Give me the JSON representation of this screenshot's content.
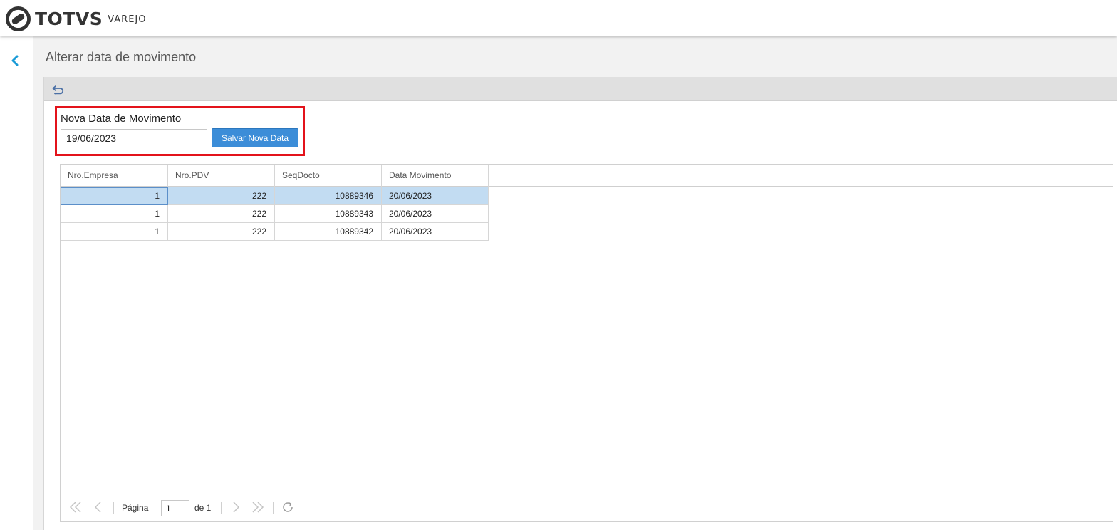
{
  "header": {
    "brand": "TOTVS",
    "product": "VAREJO"
  },
  "page": {
    "title": "Alterar data de movimento"
  },
  "form": {
    "label": "Nova Data de Movimento",
    "date_value": "19/06/2023",
    "save_label": "Salvar Nova Data"
  },
  "grid": {
    "columns": [
      "Nro.Empresa",
      "Nro.PDV",
      "SeqDocto",
      "Data Movimento"
    ],
    "rows": [
      {
        "empresa": "1",
        "pdv": "222",
        "seq": "10889346",
        "data": "20/06/2023",
        "selected": true
      },
      {
        "empresa": "1",
        "pdv": "222",
        "seq": "10889343",
        "data": "20/06/2023",
        "selected": false
      },
      {
        "empresa": "1",
        "pdv": "222",
        "seq": "10889342",
        "data": "20/06/2023",
        "selected": false
      }
    ]
  },
  "pager": {
    "page_label": "Página",
    "current_page": "1",
    "of_label": "de 1"
  },
  "icons": {
    "back": "chevron-left-icon",
    "undo": "undo-icon",
    "first": "double-chevron-left-icon",
    "prev": "chevron-left-icon",
    "next": "chevron-right-icon",
    "last": "double-chevron-right-icon",
    "refresh": "refresh-icon"
  },
  "colors": {
    "accent": "#3c8dd8",
    "highlight_border": "#e3131b",
    "selection": "#c2dcf2",
    "back_chevron": "#1a9bd7"
  }
}
